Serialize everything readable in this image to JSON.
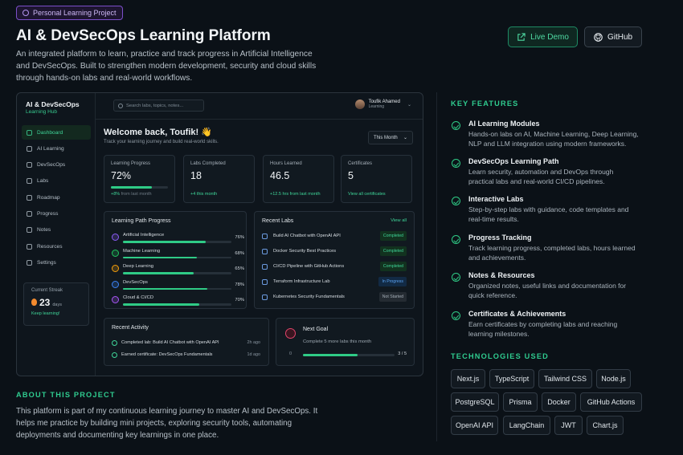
{
  "header": {
    "badge": "Personal Learning Project",
    "title": "AI & DevSecOps Learning Platform",
    "description": "An integrated platform to learn, practice and track progress in Artificial Intelligence and DevSecOps. Built to strengthen modern development, security and cloud skills through hands-on labs and real-world workflows.",
    "live_demo": "Live Demo",
    "github": "GitHub"
  },
  "mock": {
    "brand": "AI & DevSecOps",
    "brand_sub": "Learning Hub",
    "nav": [
      "Dashboard",
      "AI Learning",
      "DevSecOps",
      "Labs",
      "Roadmap",
      "Progress",
      "Notes",
      "Resources",
      "Settings"
    ],
    "search_placeholder": "Search labs, topics, notes...",
    "user_name": "Toufik Ahamed",
    "user_role": "Learning",
    "welcome": "Welcome back, Toufik! 👋",
    "welcome_sub": "Track your learning journey and build real-world skills.",
    "period": "This Month",
    "stats": [
      {
        "label": "Learning Progress",
        "value": "72%",
        "progress": 0.72,
        "sub": "+8%",
        "sub_gray": " from last month"
      },
      {
        "label": "Labs Completed",
        "value": "18",
        "sub": "+4 this month"
      },
      {
        "label": "Hours Learned",
        "value": "46.5",
        "sub": "+12.5 hrs from last month"
      },
      {
        "label": "Certificates",
        "value": "5",
        "sub": "View all certificates"
      }
    ],
    "path": {
      "title": "Learning Path Progress",
      "items": [
        {
          "name": "Artificial Intelligence",
          "pct": "76%",
          "value": 0.76,
          "color": "#8b5cf6"
        },
        {
          "name": "Machine Learning",
          "pct": "68%",
          "value": 0.68,
          "color": "#22c55e"
        },
        {
          "name": "Deep Learning",
          "pct": "65%",
          "value": 0.65,
          "color": "#f59e0b"
        },
        {
          "name": "DevSecOps",
          "pct": "78%",
          "value": 0.78,
          "color": "#3b82f6"
        },
        {
          "name": "Cloud & CI/CD",
          "pct": "70%",
          "value": 0.7,
          "color": "#a855f7"
        }
      ]
    },
    "labs": {
      "title": "Recent Labs",
      "view_all": "View all",
      "items": [
        {
          "name": "Build AI Chatbot with OpenAI API",
          "status": "Completed",
          "kind": "done"
        },
        {
          "name": "Docker Security Best Practices",
          "status": "Completed",
          "kind": "done"
        },
        {
          "name": "CI/CD Pipeline with GitHub Actions",
          "status": "Completed",
          "kind": "done"
        },
        {
          "name": "Terraform Infrastructure Lab",
          "status": "In Progress",
          "kind": "prog"
        },
        {
          "name": "Kubernetes Security Fundamentals",
          "status": "Not Started",
          "kind": "ns"
        }
      ]
    },
    "activity": {
      "title": "Recent Activity",
      "items": [
        {
          "text": "Completed lab: Build AI Chatbot with OpenAI API",
          "time": "2h ago"
        },
        {
          "text": "Earned certificate: DevSecOps Fundamentals",
          "time": "1d ago"
        }
      ]
    },
    "goal": {
      "title": "Next Goal",
      "sub": "Complete 5 more labs this month",
      "zero": "0",
      "count": "3 / 5",
      "value": 0.6
    },
    "streak": {
      "label": "Current Streak",
      "value": "23",
      "unit": "days",
      "note": "Keep learning!"
    }
  },
  "about": {
    "heading": "ABOUT THIS PROJECT",
    "text": "This platform is part of my continuous learning journey to master AI and DevSecOps. It helps me practice by building mini projects, exploring security tools, automating deployments and documenting key learnings in one place."
  },
  "features": {
    "heading": "KEY FEATURES",
    "items": [
      {
        "title": "AI Learning Modules",
        "desc": "Hands-on labs on AI, Machine Learning, Deep Learning, NLP and LLM integration using modern frameworks."
      },
      {
        "title": "DevSecOps Learning Path",
        "desc": "Learn security, automation and DevOps through practical labs and real-world CI/CD pipelines."
      },
      {
        "title": "Interactive Labs",
        "desc": "Step-by-step labs with guidance, code templates and real-time results."
      },
      {
        "title": "Progress Tracking",
        "desc": "Track learning progress, completed labs, hours learned and achievements."
      },
      {
        "title": "Notes & Resources",
        "desc": "Organized notes, useful links and documentation for quick reference."
      },
      {
        "title": "Certificates & Achievements",
        "desc": "Earn certificates by completing labs and reaching learning milestones."
      }
    ]
  },
  "technologies": {
    "heading": "TECHNOLOGIES USED",
    "items": [
      "Next.js",
      "TypeScript",
      "Tailwind CSS",
      "Node.js",
      "PostgreSQL",
      "Prisma",
      "Docker",
      "GitHub Actions",
      "OpenAI API",
      "LangChain",
      "JWT",
      "Chart.js"
    ]
  },
  "colors": {
    "accent": "#2fcb8f",
    "background": "#0b1117",
    "badge": "#7b4fc9"
  }
}
